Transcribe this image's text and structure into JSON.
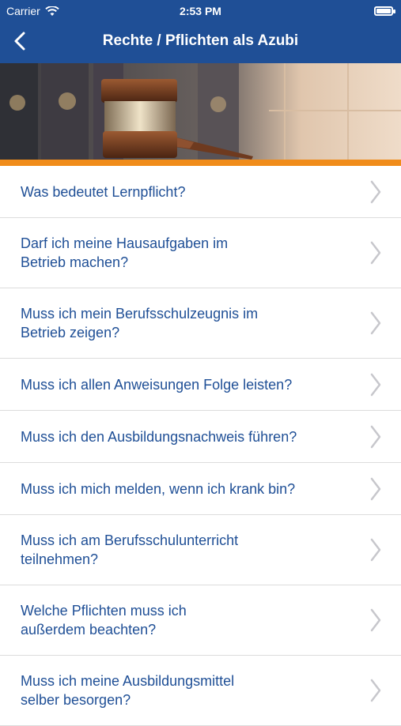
{
  "status": {
    "carrier": "Carrier",
    "time": "2:53 PM"
  },
  "navbar": {
    "title": "Rechte / Pflichten als Azubi",
    "back_icon": "chevron-left-icon"
  },
  "colors": {
    "nav_bg": "#1f4f96",
    "accent": "#f08c1a",
    "link": "#1f4f96"
  },
  "questions": [
    {
      "lines": [
        "Was bedeutet Lernpflicht?"
      ]
    },
    {
      "lines": [
        "Darf ich meine Hausaufgaben im",
        "Betrieb machen?"
      ]
    },
    {
      "lines": [
        "Muss ich mein Berufsschulzeugnis im",
        "Betrieb zeigen?"
      ]
    },
    {
      "lines": [
        "Muss ich allen Anweisungen Folge leisten?"
      ]
    },
    {
      "lines": [
        "Muss ich den Ausbildungsnachweis führen?"
      ]
    },
    {
      "lines": [
        "Muss ich mich melden, wenn ich krank bin?"
      ]
    },
    {
      "lines": [
        "Muss ich am Berufsschulunterricht",
        "teilnehmen?"
      ]
    },
    {
      "lines": [
        "Welche Pflichten muss ich",
        "außerdem beachten?"
      ]
    },
    {
      "lines": [
        "Muss ich meine Ausbildungsmittel",
        "selber besorgen?"
      ]
    }
  ]
}
